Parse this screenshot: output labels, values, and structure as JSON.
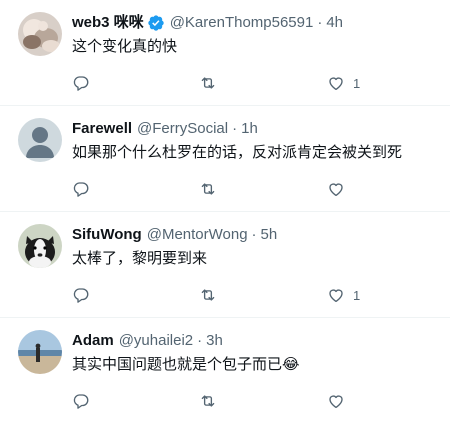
{
  "tweets": [
    {
      "name": "web3 咪咪",
      "verified": true,
      "handle": "@KarenThomp56591",
      "time": "4h",
      "text": "这个变化真的快",
      "like_count": "1",
      "avatar": "photo-avatar"
    },
    {
      "name": "Farewell",
      "verified": false,
      "handle": "@FerrySocial",
      "time": "1h",
      "text": "如果那个什么杜罗在的话，反对派肯定会被关到死",
      "like_count": "",
      "avatar": "default-avatar"
    },
    {
      "name": "SifuWong",
      "verified": false,
      "handle": "@MentorWong",
      "time": "5h",
      "text": "太棒了，黎明要到来",
      "like_count": "1",
      "avatar": "dog-avatar"
    },
    {
      "name": "Adam",
      "verified": false,
      "handle": "@yuhailei2",
      "time": "3h",
      "text": "其实中国问题也就是个包子而已",
      "emoji": "😂",
      "like_count": "",
      "avatar": "beach-avatar"
    }
  ],
  "separator": "·",
  "colors": {
    "text": "#0f1419",
    "secondary": "#536471",
    "verified": "#1d9bf0",
    "border": "#eff3f4"
  }
}
